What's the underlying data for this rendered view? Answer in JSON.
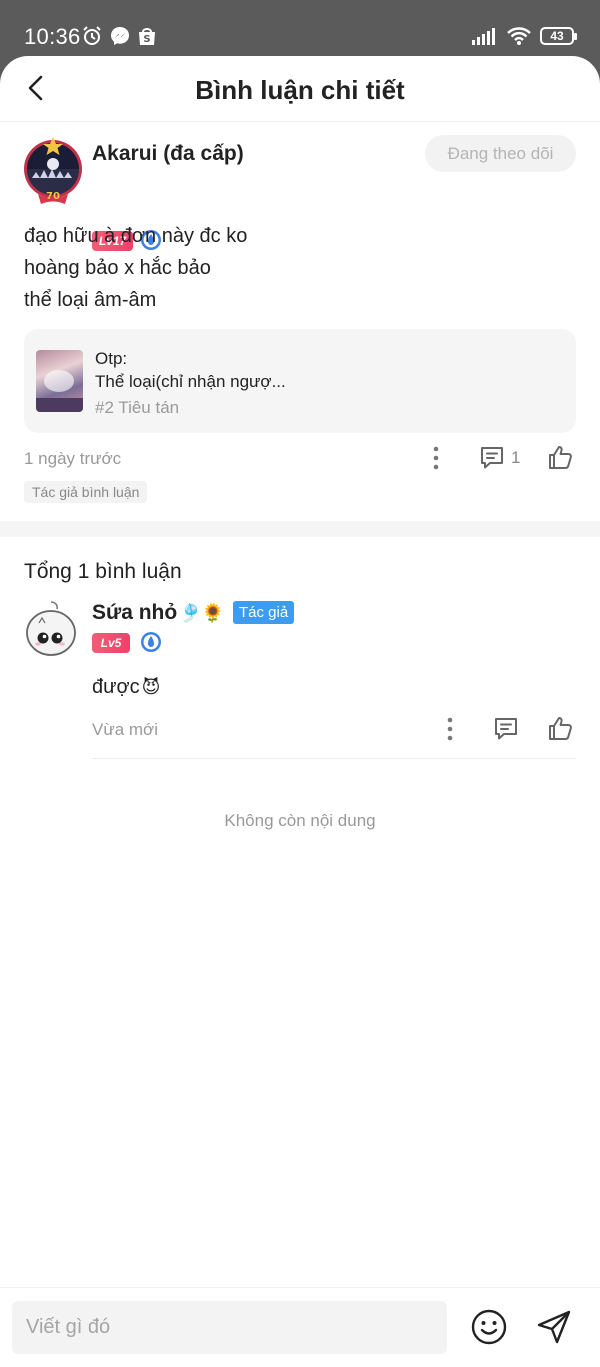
{
  "status_bar": {
    "time": "10:36",
    "battery": "43",
    "icons": [
      "alarm-icon",
      "messenger-icon",
      "shopee-icon",
      "signal-icon",
      "wifi-icon",
      "battery-icon"
    ]
  },
  "header": {
    "title": "Bình luận chi tiết",
    "back_icon": "chevron-left-icon"
  },
  "post": {
    "author": "Akarui (đa cấp)",
    "level": "Lv17",
    "follow_label": "Đang theo dõi",
    "body_lines": [
      "đạo hữu à đơn này đc ko",
      "hoàng bảo x hắc bảo",
      "thể loại âm-âm"
    ],
    "ref": {
      "line1": "Otp:",
      "line2": "Thể loại(chỉ nhận ngượ...",
      "line3": "#2 Tiêu tán"
    },
    "time": "1 ngày trước",
    "reply_count": "1",
    "author_tag": "Tác giả bình luận"
  },
  "replies": {
    "total_label": "Tổng 1 bình luận",
    "items": [
      {
        "author": "Sứa nhỏ",
        "name_emojis": "🎐🌻",
        "badge": "Tác giả",
        "level": "Lv5",
        "text": "được",
        "text_emoji": "😈",
        "time": "Vừa mới"
      }
    ],
    "end_label": "Không còn nội dung"
  },
  "composer": {
    "placeholder": "Viết gì đó"
  },
  "colors": {
    "level_badge": "#f0406a",
    "author_badge": "#3e9cf0",
    "verify": "#3b82e8"
  }
}
